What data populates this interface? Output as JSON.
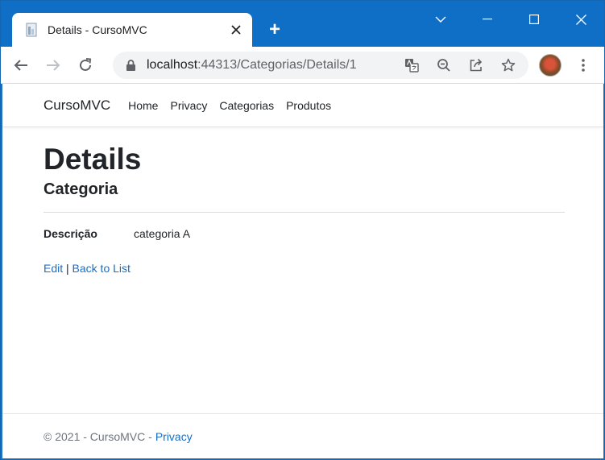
{
  "browser": {
    "tab_title": "Details - CursoMVC",
    "new_tab_symbol": "+",
    "url_host": "localhost",
    "url_path": ":44313/Categorias/Details/1",
    "colors": {
      "frame": "#0f6fc6",
      "link": "#1b6ec2"
    }
  },
  "site": {
    "brand": "CursoMVC",
    "nav": [
      "Home",
      "Privacy",
      "Categorias",
      "Produtos"
    ]
  },
  "main": {
    "title": "Details",
    "subtitle": "Categoria",
    "field_label": "Descrição",
    "field_value": "categoria A",
    "edit_link": "Edit",
    "separator": "|",
    "back_link": "Back to List"
  },
  "footer": {
    "copyright": "© 2021 - CursoMVC -",
    "privacy_link": "Privacy"
  }
}
